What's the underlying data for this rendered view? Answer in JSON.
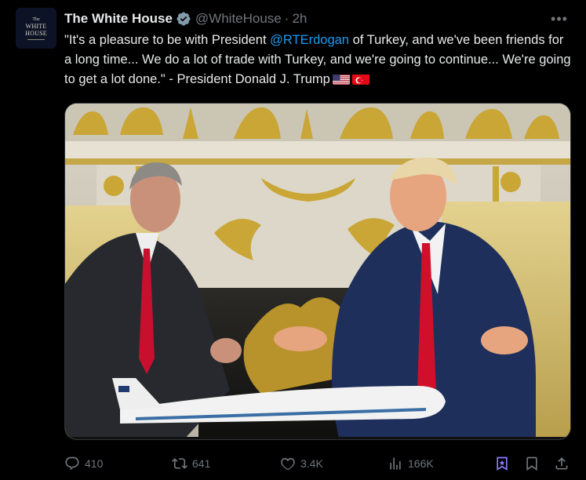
{
  "tweet": {
    "author": {
      "display_name": "The White House",
      "handle": "@WhiteHouse",
      "verified": true,
      "avatar": {
        "top": "The",
        "line1": "WHITE",
        "line2": "HOUSE"
      }
    },
    "separator": "·",
    "time": "2h",
    "more_icon": "more-horizontal-icon",
    "text": {
      "part1": "\"It's a pleasure to be with President ",
      "mention": "@RTErdogan",
      "part2": " of Turkey, and we've been friends for a long time... We do a lot of trade with Turkey, and we're going to continue... We're going to get a lot done.\" - President Donald J. Trump",
      "flags": [
        "us-flag",
        "turkey-flag"
      ]
    },
    "media": {
      "type": "photo"
    },
    "actions": {
      "replies": "410",
      "reposts": "641",
      "likes": "3.4K",
      "views": "166K"
    }
  },
  "colors": {
    "background": "#000000",
    "text": "#e7e9ea",
    "muted": "#71767b",
    "accent": "#1d9bf0",
    "grok": "#8b7cf6"
  }
}
